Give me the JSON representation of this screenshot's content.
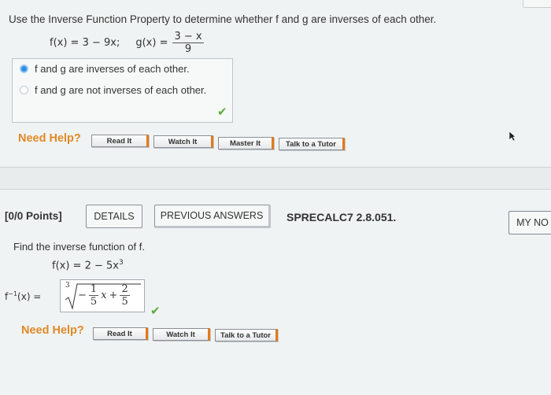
{
  "q1": {
    "prompt": "Use the Inverse Function Property to determine whether f and g are inverses of each other.",
    "f_expr": "f(x) = 3 − 9x;",
    "g_lhs": "g(x) =",
    "g_num": "3 − x",
    "g_den": "9",
    "choices": [
      {
        "text": "f and g are inverses of each other.",
        "selected": true
      },
      {
        "text": "f and g are not inverses of each other.",
        "selected": false
      }
    ],
    "need_help": "Need Help?",
    "buttons": [
      "Read It",
      "Watch It",
      "Master It",
      "Talk to a Tutor"
    ]
  },
  "q2": {
    "points": "[0/0 Points]",
    "details": "DETAILS",
    "previous_answers": "PREVIOUS ANSWERS",
    "code": "SPRECALC7 2.8.051.",
    "my_notes": "MY NO",
    "prompt": "Find the inverse function of f.",
    "f_expr": "f(x) = 2 − 5x",
    "f_exp": "3",
    "finv_lhs": "f",
    "finv_sup": "−1",
    "finv_rest": "(x) =",
    "root_index": "3",
    "minus": "−",
    "a_num": "1",
    "a_den": "5",
    "var": "x",
    "plus": "+",
    "b_num": "2",
    "b_den": "5",
    "need_help": "Need Help?",
    "buttons": [
      "Read It",
      "Watch It",
      "Talk to a Tutor"
    ]
  },
  "colors": {
    "accent": "#e08a26",
    "radio": "#2f8ee6",
    "check": "#5bab3a"
  }
}
